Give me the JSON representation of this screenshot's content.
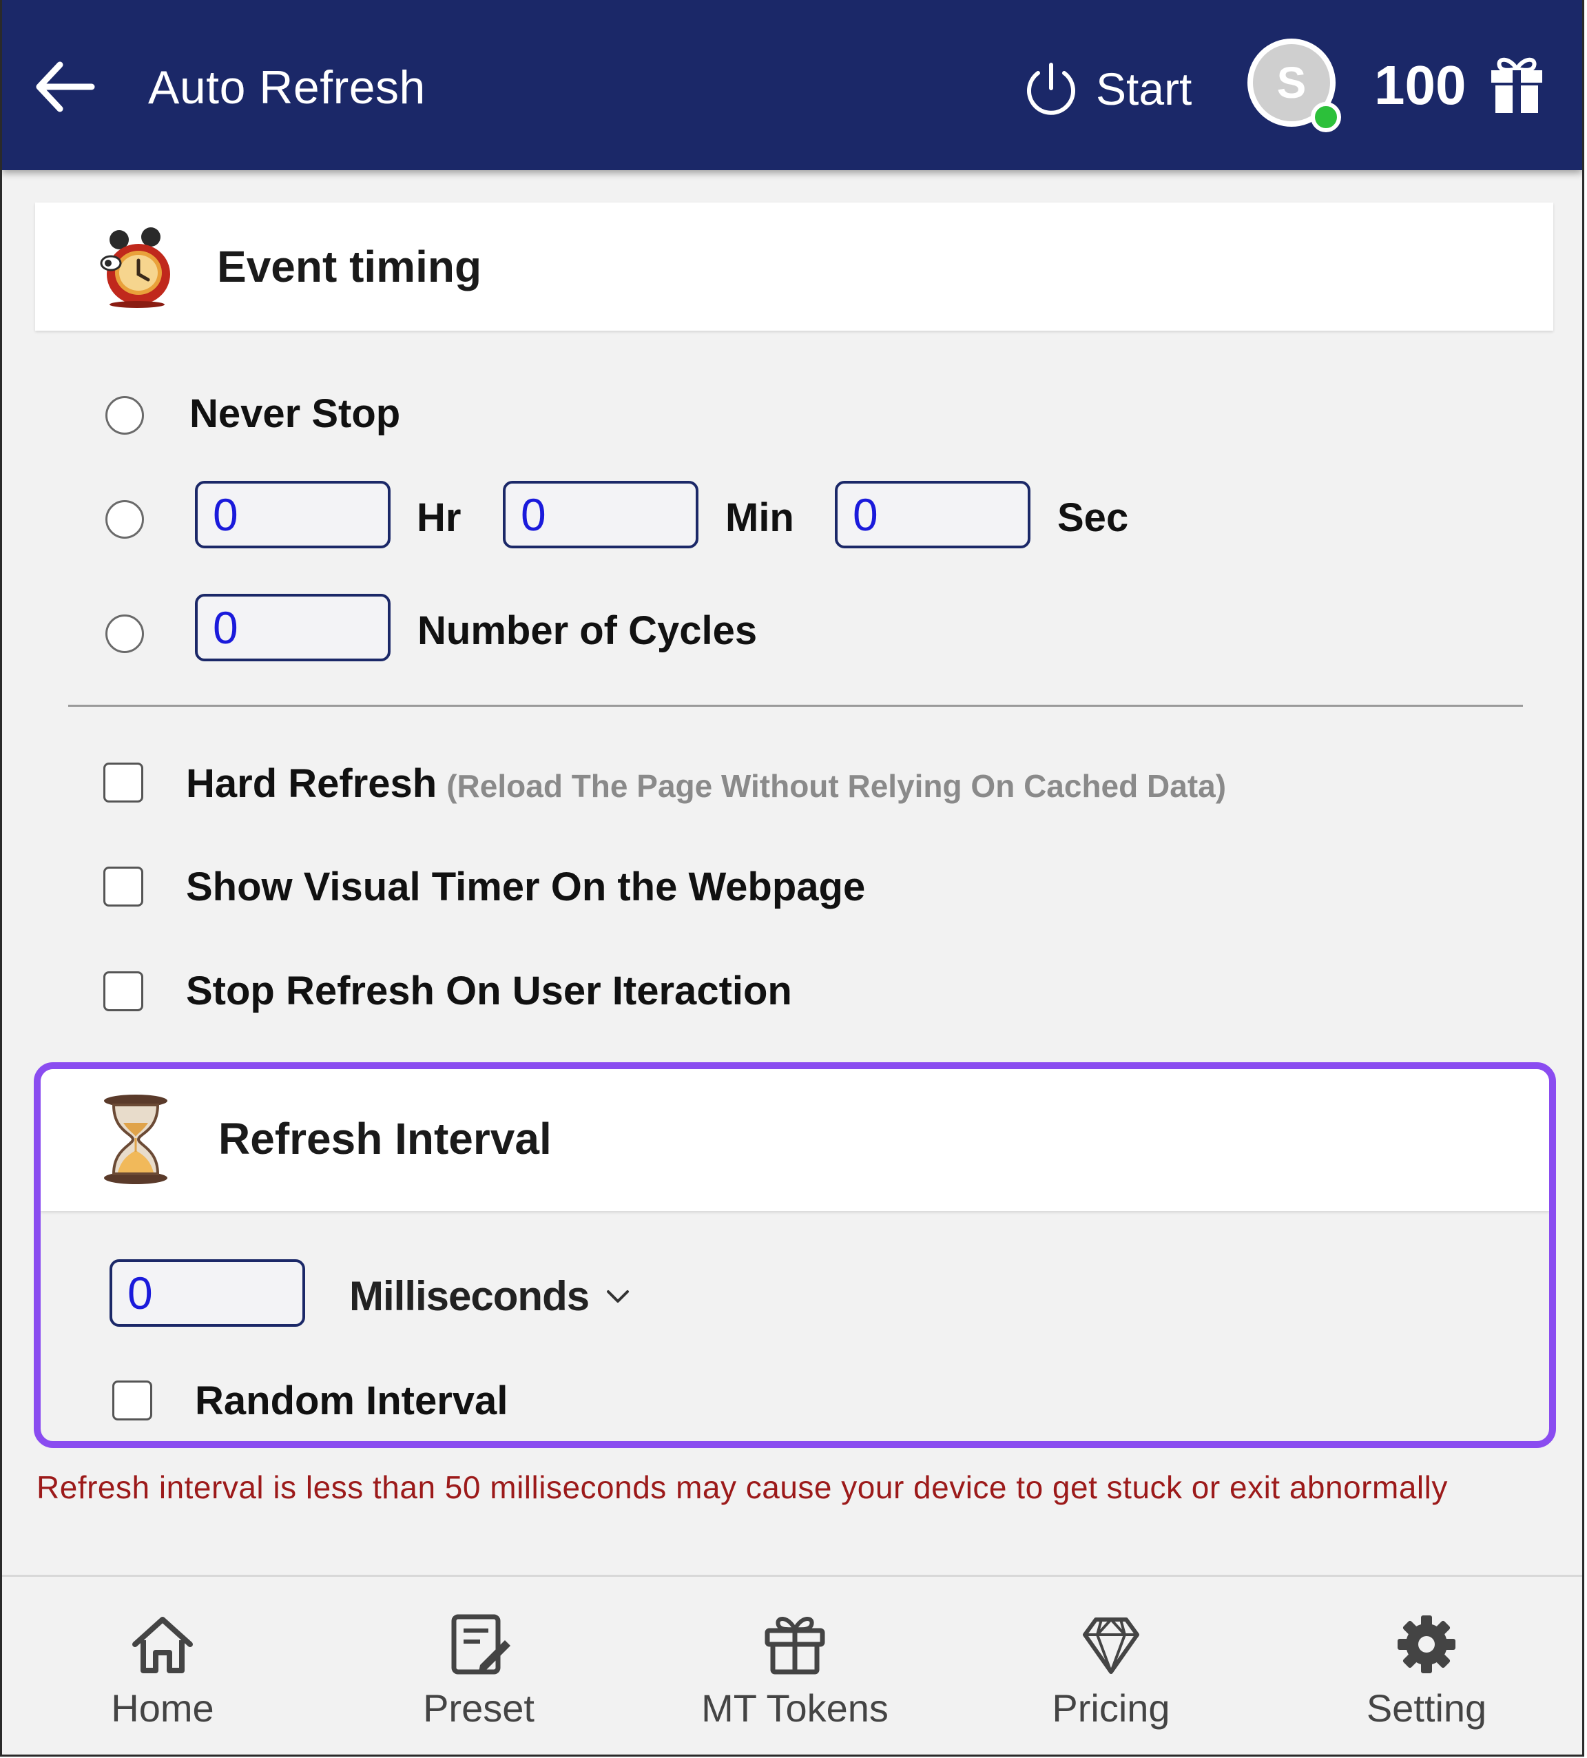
{
  "header": {
    "title": "Auto Refresh",
    "start_label": "Start",
    "avatar_letter": "S",
    "tokens": "100"
  },
  "event_timing": {
    "title": "Event timing",
    "never_stop_label": "Never Stop",
    "hr_value": "0",
    "hr_label": "Hr",
    "min_value": "0",
    "min_label": "Min",
    "sec_value": "0",
    "sec_label": "Sec",
    "cycles_value": "0",
    "cycles_label": "Number of Cycles"
  },
  "options": {
    "hard_refresh_label": "Hard Refresh",
    "hard_refresh_note": "(Reload The Page Without Relying On Cached Data)",
    "visual_timer_label": "Show Visual Timer On the Webpage",
    "stop_on_interaction_label": "Stop Refresh On User Iteraction"
  },
  "refresh_interval": {
    "title": "Refresh Interval",
    "value": "0",
    "unit": "Milliseconds",
    "random_label": "Random Interval"
  },
  "warning": "Refresh interval is less than 50 milliseconds may cause your device to get stuck or exit abnormally",
  "nav": {
    "home": "Home",
    "preset": "Preset",
    "mt_tokens": "MT Tokens",
    "pricing": "Pricing",
    "setting": "Setting"
  },
  "colors": {
    "header_bg": "#1b2868",
    "highlight_border": "#8a4cf0",
    "warning_text": "#9c1a1a",
    "online_dot": "#2cc03a",
    "input_text": "#1a1adb"
  }
}
